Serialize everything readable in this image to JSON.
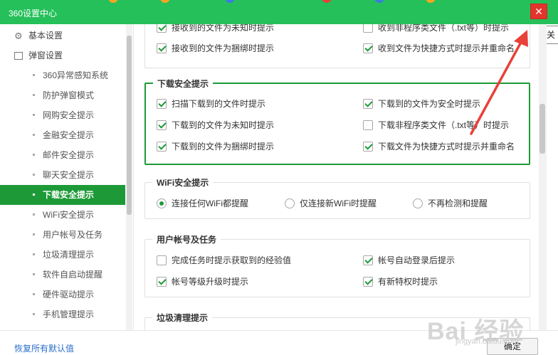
{
  "window": {
    "title": "360设置中心",
    "close_glyph": "✕",
    "tooltip": "关"
  },
  "sidebar": {
    "sections": [
      {
        "label": "基本设置",
        "icon": "gear-icon"
      },
      {
        "label": "弹窗设置",
        "icon": "window-icon"
      }
    ],
    "items": [
      {
        "label": "360异常感知系统"
      },
      {
        "label": "防护弹窗模式"
      },
      {
        "label": "网购安全提示"
      },
      {
        "label": "金融安全提示"
      },
      {
        "label": "邮件安全提示"
      },
      {
        "label": "聊天安全提示"
      },
      {
        "label": "下载安全提示",
        "active": true
      },
      {
        "label": "WiFi安全提示"
      },
      {
        "label": "用户帐号及任务"
      },
      {
        "label": "垃圾清理提示"
      },
      {
        "label": "软件自启动提醒"
      },
      {
        "label": "硬件驱动提示"
      },
      {
        "label": "手机管理提示"
      }
    ]
  },
  "main": {
    "chat_group": {
      "options": [
        {
          "label": "接收到的文件为未知时提示",
          "checked": true
        },
        {
          "label": "收到非程序类文件（.txt等）时提示",
          "checked": false
        },
        {
          "label": "接收到的文件为捆绑时提示",
          "checked": true
        },
        {
          "label": "收到文件为快捷方式时提示并重命名",
          "checked": true
        }
      ]
    },
    "download_group": {
      "title": "下载安全提示",
      "options": [
        {
          "label": "扫描下载到的文件时提示",
          "checked": true
        },
        {
          "label": "下载到的文件为安全时提示",
          "checked": true
        },
        {
          "label": "下载到的文件为未知时提示",
          "checked": true
        },
        {
          "label": "下载非程序类文件（.txt等）时提示",
          "checked": false
        },
        {
          "label": "下载到的文件为捆绑时提示",
          "checked": true
        },
        {
          "label": "下载文件为快捷方式时提示并重命名",
          "checked": true
        }
      ]
    },
    "wifi_group": {
      "title": "WiFi安全提示",
      "options": [
        {
          "label": "连接任何WiFi都提醒",
          "selected": true
        },
        {
          "label": "仅连接新WiFi时提醒",
          "selected": false
        },
        {
          "label": "不再检测和提醒",
          "selected": false
        }
      ]
    },
    "account_group": {
      "title": "用户帐号及任务",
      "options": [
        {
          "label": "完成任务时提示获取到的经验值",
          "checked": false
        },
        {
          "label": "帐号自动登录后提示",
          "checked": true
        },
        {
          "label": "帐号等级升级时提示",
          "checked": true
        },
        {
          "label": "有新特权时提示",
          "checked": true
        }
      ]
    },
    "trash_group": {
      "title": "垃圾清理提示"
    }
  },
  "footer": {
    "restore_label": "恢复所有默认值",
    "ok_label": "确定"
  },
  "watermark": {
    "text": "Bai 经验",
    "sub": "jingyan.baidu.com"
  },
  "colors": {
    "brand_green": "#25c05a",
    "accent_green": "#1d9a37",
    "close_red": "#e2352c",
    "arrow_red": "#e8413a"
  }
}
